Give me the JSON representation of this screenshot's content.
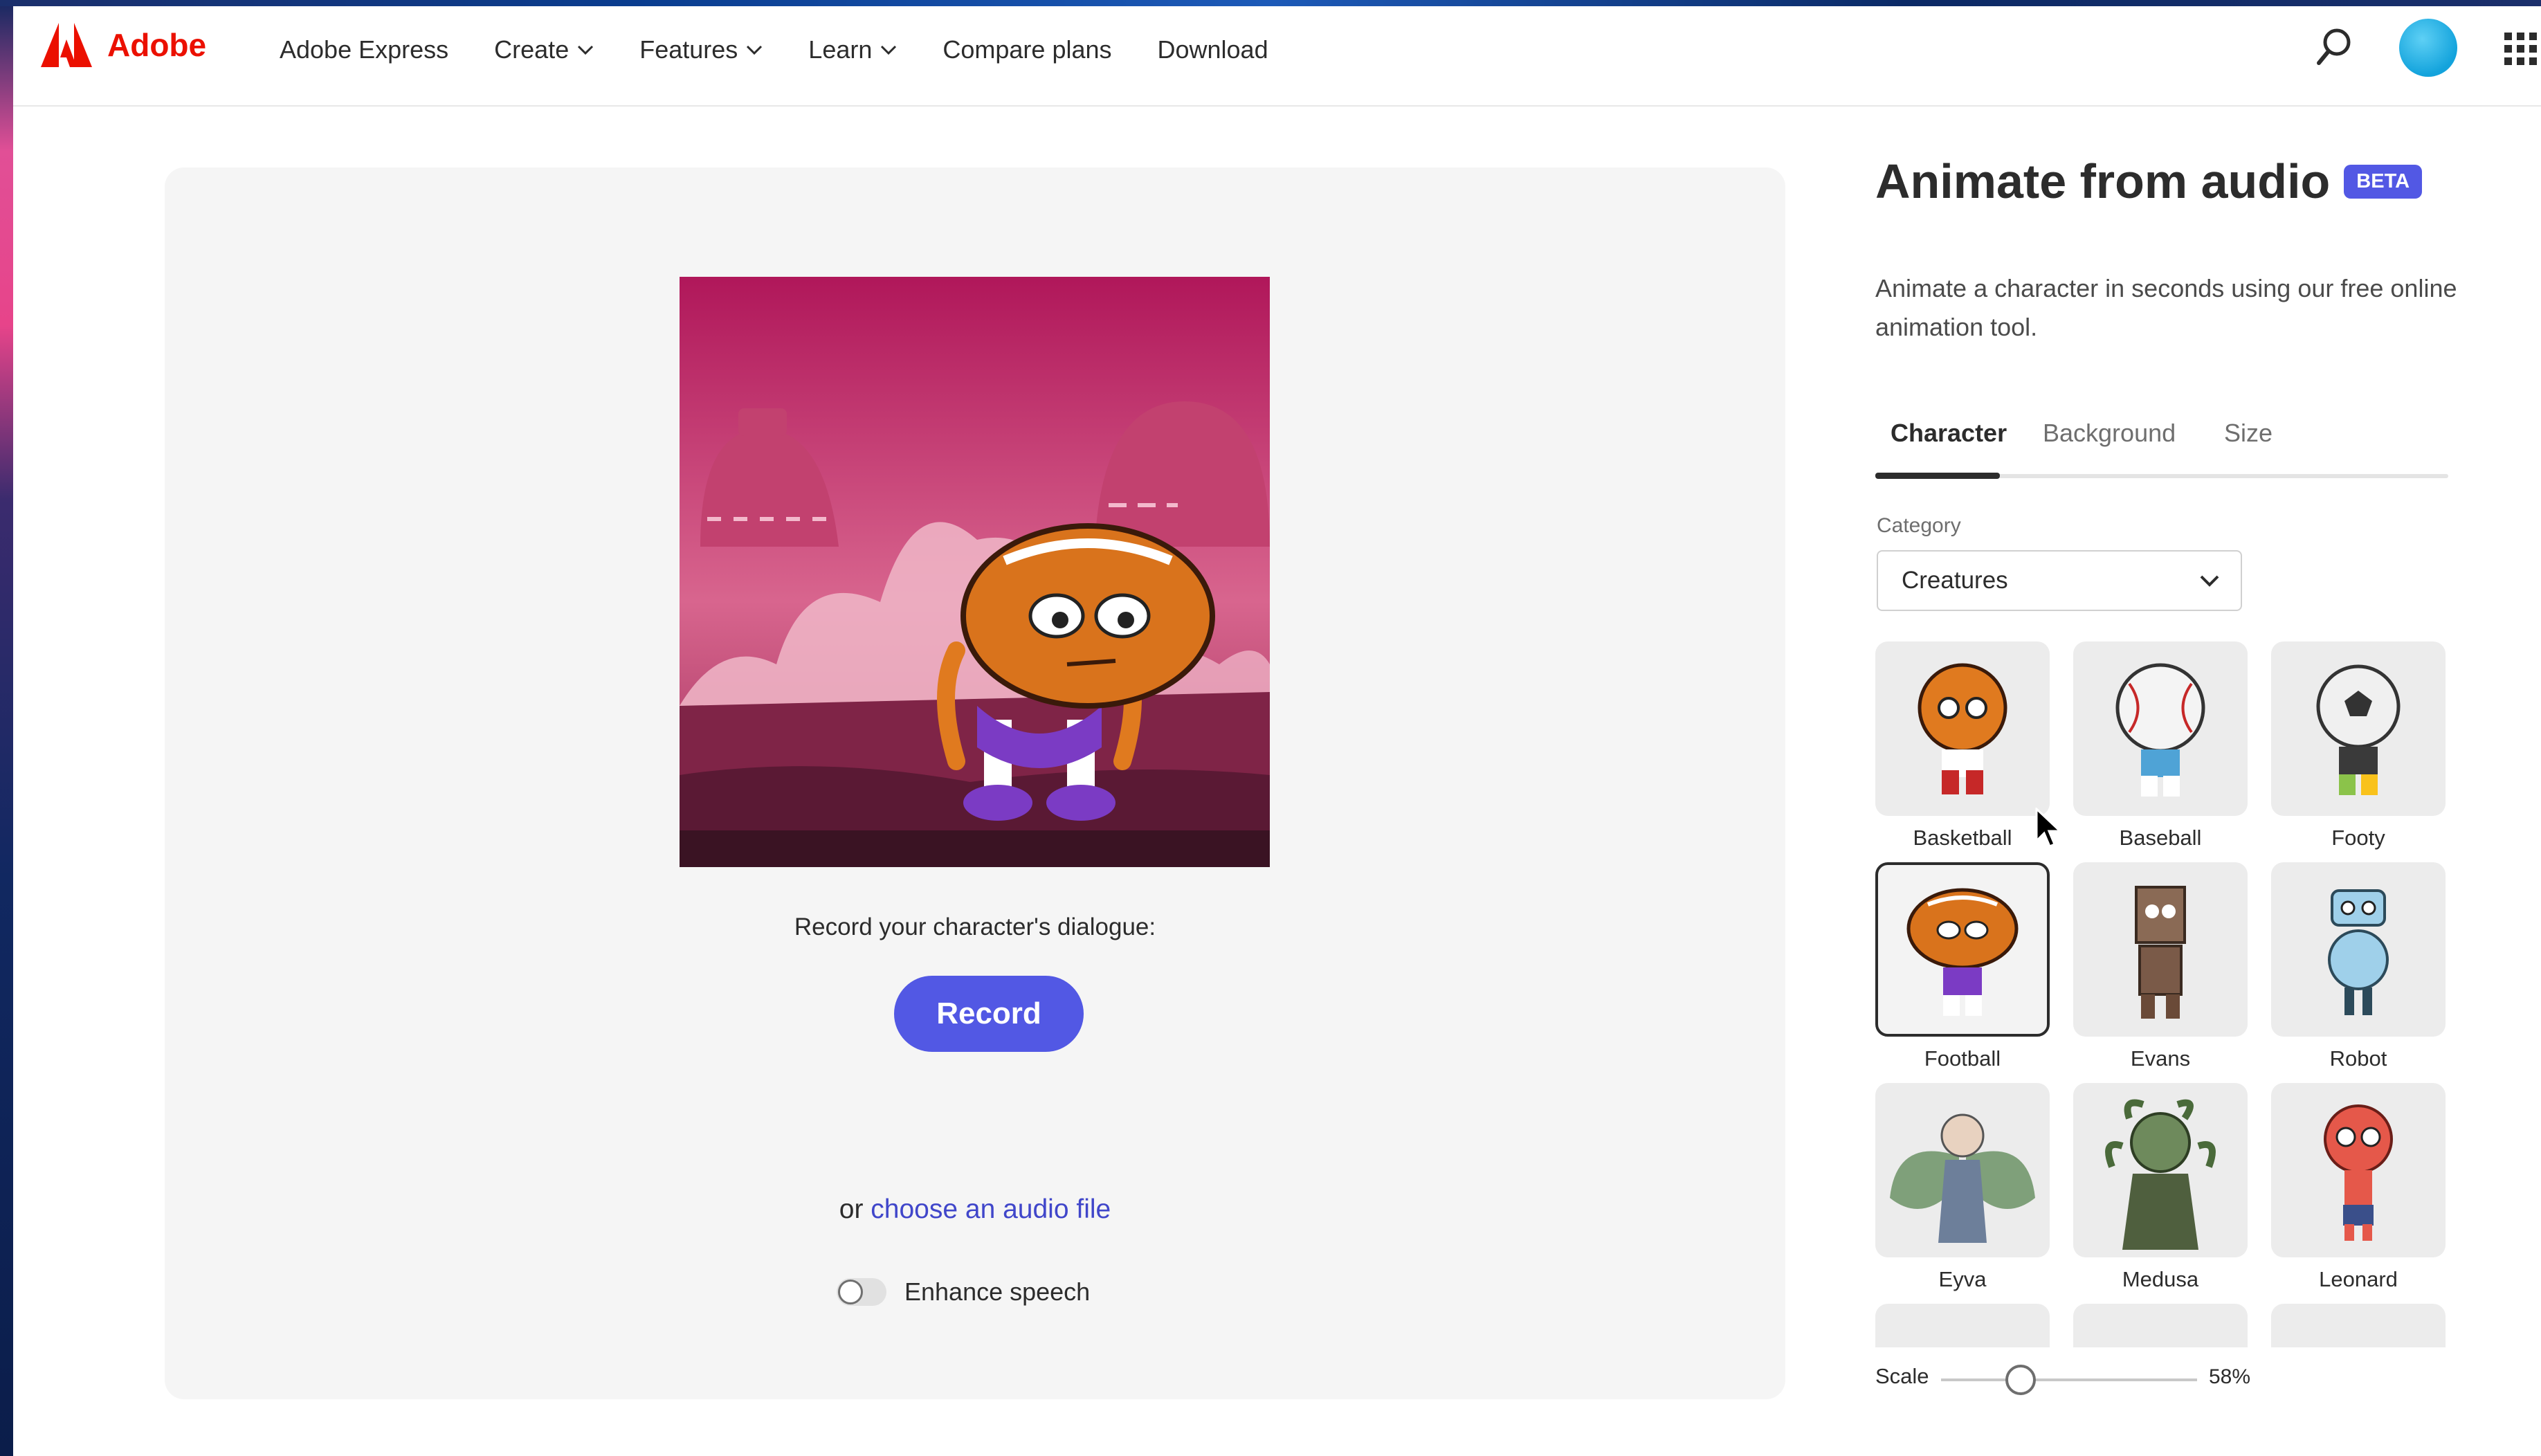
{
  "brand": {
    "name": "Adobe",
    "color": "#eb1000"
  },
  "nav": {
    "items": [
      {
        "label": "Adobe Express",
        "dropdown": false
      },
      {
        "label": "Create",
        "dropdown": true
      },
      {
        "label": "Features",
        "dropdown": true
      },
      {
        "label": "Learn",
        "dropdown": true
      },
      {
        "label": "Compare plans",
        "dropdown": false
      },
      {
        "label": "Download",
        "dropdown": false
      }
    ],
    "icons": [
      "search-icon",
      "avatar",
      "apps-grid-icon"
    ]
  },
  "stage": {
    "dialogue_prompt": "Record your character's dialogue:",
    "record_label": "Record",
    "alt_prefix": "or",
    "alt_link": "choose an audio file",
    "enhance_label": "Enhance speech",
    "enhance_on": false
  },
  "panel": {
    "title": "Animate from audio",
    "badge": "BETA",
    "description": "Animate a character in seconds using our free online animation tool.",
    "tabs": [
      {
        "label": "Character",
        "active": true
      },
      {
        "label": "Background",
        "active": false
      },
      {
        "label": "Size",
        "active": false
      }
    ],
    "category_label": "Category",
    "category_value": "Creatures",
    "characters": [
      {
        "label": "Basketball",
        "selected": false
      },
      {
        "label": "Baseball",
        "selected": false
      },
      {
        "label": "Footy",
        "selected": false
      },
      {
        "label": "Football",
        "selected": true
      },
      {
        "label": "Evans",
        "selected": false
      },
      {
        "label": "Robot",
        "selected": false
      },
      {
        "label": "Eyva",
        "selected": false
      },
      {
        "label": "Medusa",
        "selected": false
      },
      {
        "label": "Leonard",
        "selected": false
      }
    ],
    "scale_label": "Scale",
    "scale_value": "58%",
    "scale_fraction": 0.58
  },
  "colors": {
    "accent": "#5258e4",
    "link": "#4046ca",
    "text": "#2c2c2c"
  }
}
